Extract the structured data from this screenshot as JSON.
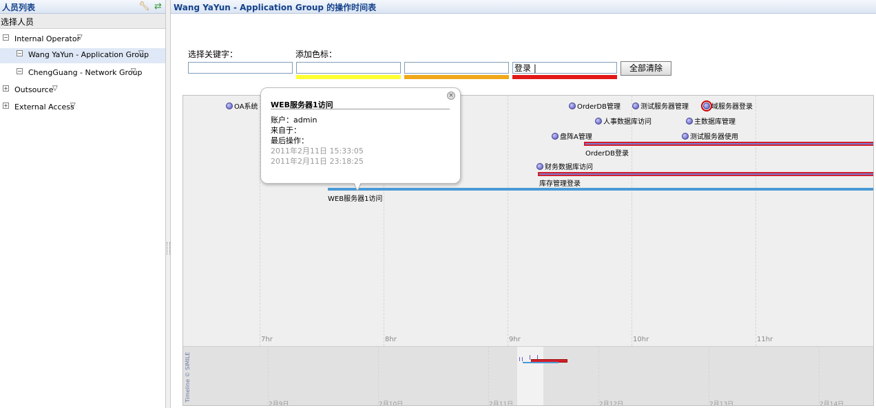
{
  "left_panel": {
    "title": "人员列表",
    "tool_icons": [
      "wrench-icon",
      "refresh-icon"
    ],
    "subheader": "选择人员",
    "tree": [
      {
        "label": "Internal Operator",
        "expanded": true,
        "level": 0
      },
      {
        "label": "Wang YaYun - Application Group",
        "expanded": true,
        "level": 1,
        "selected": true
      },
      {
        "label": "ChengGuang - Network Group",
        "expanded": true,
        "level": 1
      },
      {
        "label": "Outsource",
        "expanded": false,
        "level": 0
      },
      {
        "label": "External Access",
        "expanded": false,
        "level": 0
      }
    ]
  },
  "main": {
    "title": "Wang YaYun - Application Group 的操作时间表",
    "keyword_label": "选择关键字：",
    "color_label": "添加色标：",
    "keyword_value": "",
    "color_inputs": [
      {
        "value": "",
        "color": "#ffff33"
      },
      {
        "value": "",
        "color": "#f0a81a"
      },
      {
        "value": "登录 |",
        "color": "#e31818"
      }
    ],
    "clear_button": "全部清除"
  },
  "timeline": {
    "hours": [
      "7hr",
      "8hr",
      "9hr",
      "10hr",
      "11hr"
    ],
    "events": [
      {
        "label": "OA系统",
        "highlight": false
      },
      {
        "label": "OrderDB管理",
        "highlight": false
      },
      {
        "label": "测试服务器管理",
        "highlight": false
      },
      {
        "label": "域服务器登录",
        "highlight": true
      },
      {
        "label": "人事数据库访问",
        "highlight": false
      },
      {
        "label": "主数据库管理",
        "highlight": false
      },
      {
        "label": "盘阵A管理",
        "highlight": false
      },
      {
        "label": "测试服务器使用",
        "highlight": false
      },
      {
        "label": "财务数据库访问",
        "highlight": false
      }
    ],
    "durations": [
      {
        "label": "OrderDB登录",
        "color": "#d21f2b"
      },
      {
        "label": "库存管理登录",
        "color": "#d21f2b"
      },
      {
        "label": "WEB服务器1访问",
        "color": "#4a9ad6"
      }
    ],
    "overview_dates": [
      "2月9日",
      "2月10日",
      "2月11日",
      "2月12日",
      "2月13日",
      "2月14日"
    ],
    "credit": "Timeline © SIMILE"
  },
  "popup": {
    "title": "WEB服务器1访问",
    "account": "账户：admin",
    "from": "来自于：",
    "last_op": "最后操作：",
    "times": [
      "2011年2月11日 15:33:05",
      "2011年2月11日 23:18:25"
    ]
  }
}
